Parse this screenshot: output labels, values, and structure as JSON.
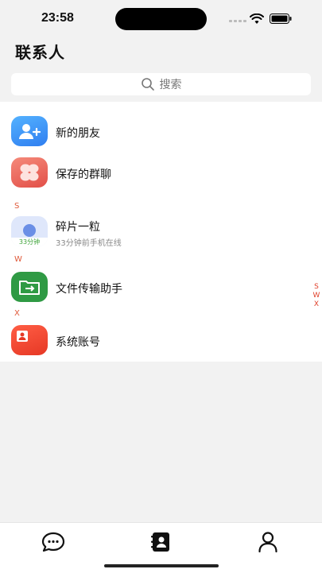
{
  "status_bar": {
    "time": "23:58"
  },
  "header": {
    "title": "联系人"
  },
  "search": {
    "placeholder": "搜索"
  },
  "contacts": {
    "new_friends": "新的朋友",
    "saved_groups": "保存的群聊",
    "sections": [
      {
        "letter": "S",
        "items": [
          {
            "name": "碎片一粒",
            "status": "33分钟前手机在线",
            "avatar_badge": "33分钟"
          }
        ]
      },
      {
        "letter": "W",
        "items": [
          {
            "name": "文件传输助手"
          }
        ]
      },
      {
        "letter": "X",
        "items": [
          {
            "name": "系统账号"
          }
        ]
      }
    ]
  },
  "index_bar": [
    "S",
    "W",
    "X"
  ],
  "tab_bar": {
    "tabs": [
      {
        "icon": "chat-bubble-icon"
      },
      {
        "icon": "contacts-book-icon",
        "active": true
      },
      {
        "icon": "person-icon"
      }
    ]
  },
  "colors": {
    "accent_red": "#e0412b",
    "new_friend_blue": "#3b8df5",
    "group_red": "#ef6b62",
    "file_green": "#2f9a44",
    "system_red": "#f0442f"
  }
}
